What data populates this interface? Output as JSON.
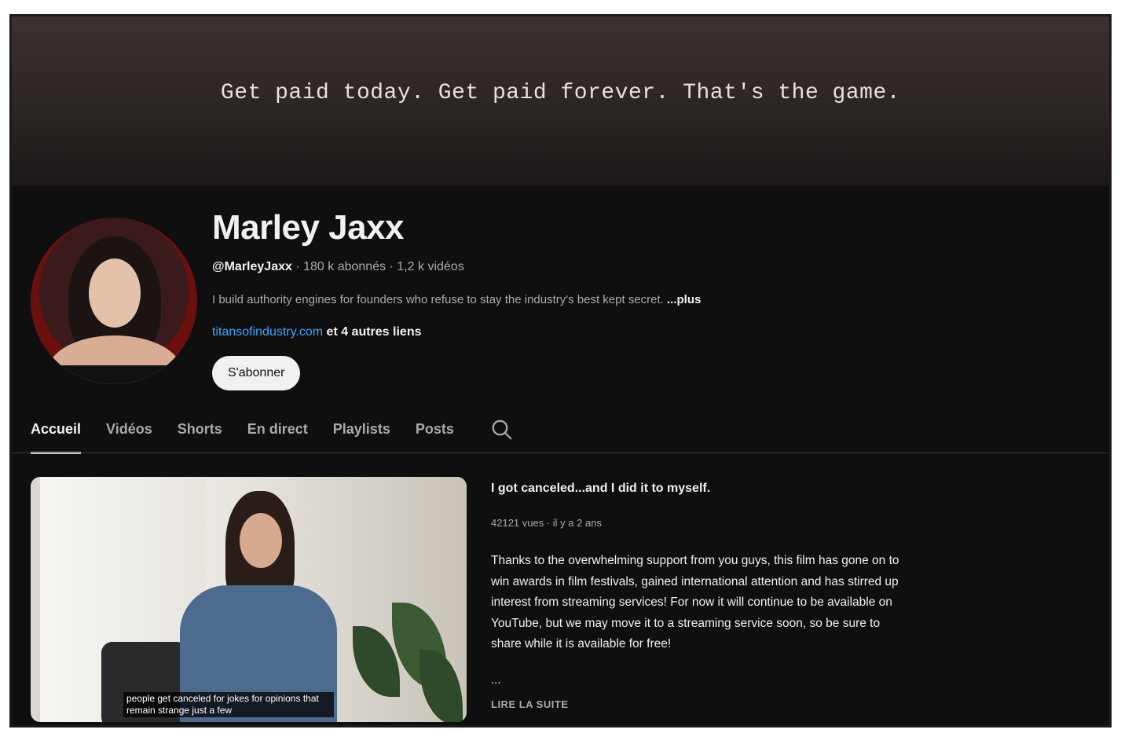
{
  "banner": {
    "tagline": "Get paid today. Get paid forever. That's the game."
  },
  "channel": {
    "name": "Marley Jaxx",
    "handle": "@MarleyJaxx",
    "separator": " · ",
    "subscribers": "180 k abonnés",
    "videos": "1,2 k vidéos",
    "description": "I build authority engines for founders who refuse to stay the industry's best kept secret. ",
    "more_label": "...plus",
    "link": "titansofindustry.com",
    "other_links": " et 4 autres liens",
    "subscribe_label": "S'abonner"
  },
  "tabs": [
    {
      "label": "Accueil",
      "active": true
    },
    {
      "label": "Vidéos",
      "active": false
    },
    {
      "label": "Shorts",
      "active": false
    },
    {
      "label": "En direct",
      "active": false
    },
    {
      "label": "Playlists",
      "active": false
    },
    {
      "label": "Posts",
      "active": false
    }
  ],
  "search_icon": "search-icon",
  "featured_video": {
    "title": "I got canceled...and I did it to myself.",
    "meta": "42121 vues · il y a 2 ans",
    "description": "Thanks to the overwhelming support from you guys, this film has gone on to win awards in film festivals, gained international attention and has stirred up interest from streaming services! For now it will continue to be available on YouTube, but we may move it to a streaming service soon, so be sure to share while it is available for free!",
    "ellipsis": "...",
    "read_more": "LIRE LA SUITE",
    "caption": "people get canceled for jokes for opinions that remain strange just a few"
  },
  "colors": {
    "background": "#0f0f0f",
    "text": "#f1f1f1",
    "muted": "#aaaaaa",
    "link": "#3ea6ff"
  }
}
